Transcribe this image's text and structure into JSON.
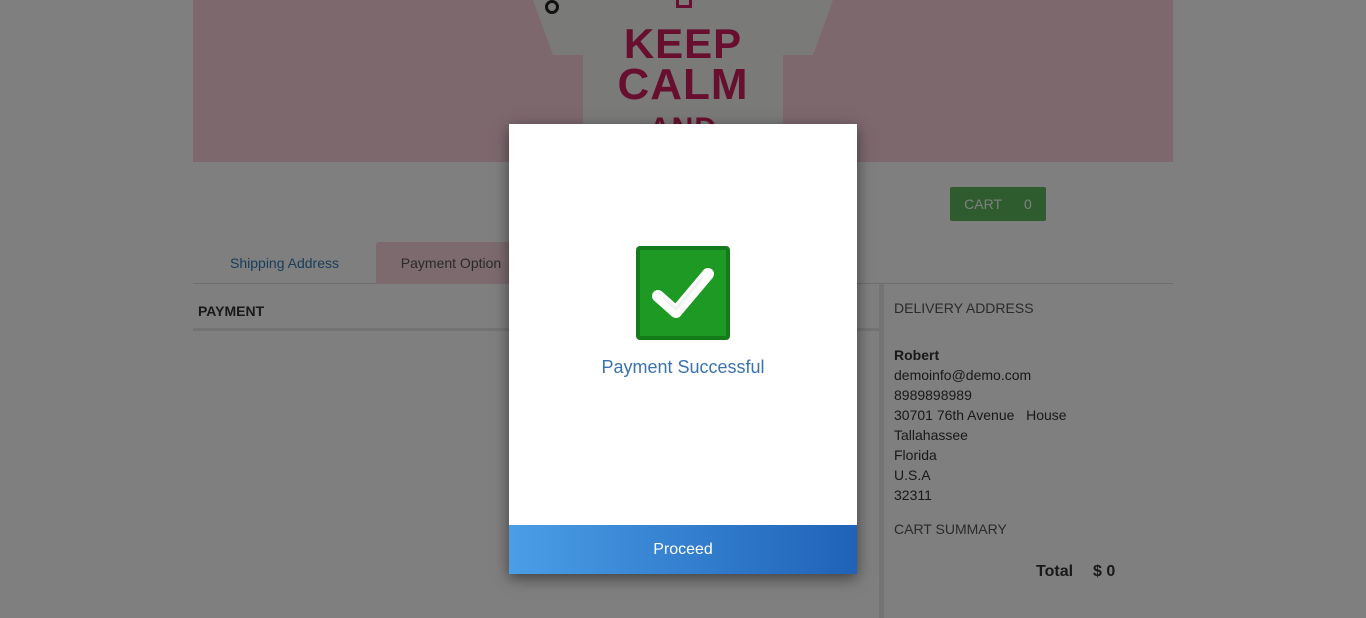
{
  "banner": {
    "shirt_line1": "KEEP",
    "shirt_line2": "CALM",
    "shirt_line3": "AND"
  },
  "cart": {
    "label": "CART",
    "count": "0"
  },
  "tabs": [
    {
      "label": "Shipping Address"
    },
    {
      "label": "Payment Option"
    }
  ],
  "payment": {
    "heading": "PAYMENT"
  },
  "delivery": {
    "title": "DELIVERY ADDRESS",
    "name": "Robert",
    "email": "demoinfo@demo.com",
    "phone": "8989898989",
    "street": "30701 76th Avenue   House",
    "city": "Tallahassee",
    "state": "Florida",
    "country": "U.S.A",
    "zip": "32311"
  },
  "cart_summary": {
    "title": "CART SUMMARY",
    "total_label": "Total",
    "total_value": "$ 0"
  },
  "modal": {
    "message": "Payment Successful",
    "proceed_label": "Proceed"
  },
  "colors": {
    "success_green": "#1e9a24",
    "cart_green": "#5cb85c",
    "link_blue": "#337ab7",
    "tab_pink": "#f9d5df",
    "proceed_gradient_start": "#4a9ee6",
    "proceed_gradient_end": "#1f62b8"
  }
}
